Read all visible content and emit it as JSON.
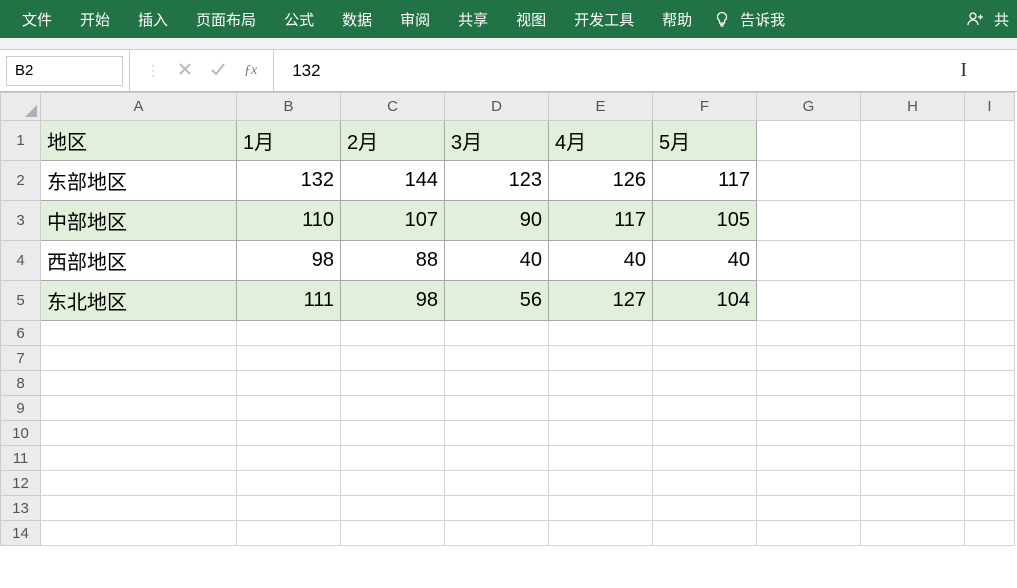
{
  "ribbon": {
    "tabs": [
      "文件",
      "开始",
      "插入",
      "页面布局",
      "公式",
      "数据",
      "审阅",
      "共享",
      "视图",
      "开发工具",
      "帮助"
    ],
    "tell_me": "告诉我",
    "share": "共"
  },
  "formula_bar": {
    "name_box": "B2",
    "formula": "132"
  },
  "columns": [
    "A",
    "B",
    "C",
    "D",
    "E",
    "F",
    "G",
    "H",
    "I"
  ],
  "rows": [
    "1",
    "2",
    "3",
    "4",
    "5",
    "6",
    "7",
    "8",
    "9",
    "10",
    "11",
    "12",
    "13",
    "14"
  ],
  "data": {
    "headers": [
      "地区",
      "1月",
      "2月",
      "3月",
      "4月",
      "5月"
    ],
    "body": [
      {
        "region": "东部地区",
        "vals": [
          132,
          144,
          123,
          126,
          117
        ]
      },
      {
        "region": "中部地区",
        "vals": [
          110,
          107,
          90,
          117,
          105
        ]
      },
      {
        "region": "西部地区",
        "vals": [
          98,
          88,
          40,
          40,
          40
        ]
      },
      {
        "region": "东北地区",
        "vals": [
          111,
          98,
          56,
          127,
          104
        ]
      }
    ]
  },
  "chart_data": {
    "type": "table",
    "title": "",
    "categories": [
      "1月",
      "2月",
      "3月",
      "4月",
      "5月"
    ],
    "series": [
      {
        "name": "东部地区",
        "values": [
          132,
          144,
          123,
          126,
          117
        ]
      },
      {
        "name": "中部地区",
        "values": [
          110,
          107,
          90,
          117,
          105
        ]
      },
      {
        "name": "西部地区",
        "values": [
          98,
          88,
          40,
          40,
          40
        ]
      },
      {
        "name": "东北地区",
        "values": [
          111,
          98,
          56,
          127,
          104
        ]
      }
    ]
  }
}
